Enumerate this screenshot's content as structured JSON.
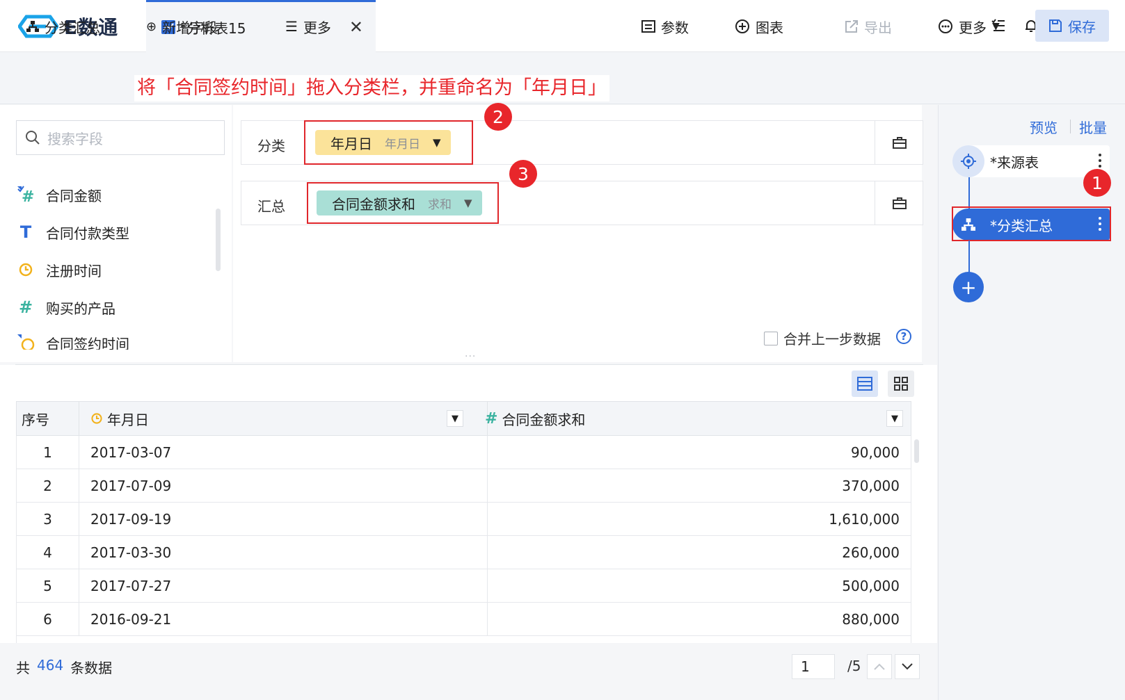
{
  "app": {
    "brand": "E数通"
  },
  "tab": {
    "title": "*分析表15",
    "close": "✕"
  },
  "toolbar": {
    "group_summary": "分类汇总",
    "new_field": "新增字段",
    "more_left": "更多",
    "params": "参数",
    "chart": "图表",
    "export": "导出",
    "more": "更多",
    "save": "保存"
  },
  "annotation": {
    "text": "将「合同签约时间」拖入分类栏，并重命名为「年月日」",
    "badge1": "1",
    "badge2": "2",
    "badge3": "3"
  },
  "search": {
    "placeholder": "搜索字段"
  },
  "fields": [
    {
      "label": "合同金额",
      "icon": "number-check-icon"
    },
    {
      "label": "合同付款类型",
      "icon": "text-icon"
    },
    {
      "label": "注册时间",
      "icon": "clock-icon"
    },
    {
      "label": "购买的产品",
      "icon": "number-icon"
    },
    {
      "label": "合同签约时间",
      "icon": "clock-check-icon"
    }
  ],
  "config": {
    "category_label": "分类",
    "category_pill": "年月日",
    "category_pill_sub": "年月日",
    "summary_label": "汇总",
    "summary_pill": "合同金额求和",
    "summary_pill_sub": "求和",
    "merge_label": "合并上一步数据",
    "help": "?"
  },
  "table": {
    "headers": [
      "序号",
      "年月日",
      "合同金额求和"
    ],
    "rows": [
      [
        "1",
        "2017-03-07",
        "90,000"
      ],
      [
        "2",
        "2017-07-09",
        "370,000"
      ],
      [
        "3",
        "2017-09-19",
        "1,610,000"
      ],
      [
        "4",
        "2017-03-30",
        "260,000"
      ],
      [
        "5",
        "2017-07-27",
        "500,000"
      ],
      [
        "6",
        "2016-09-21",
        "880,000"
      ]
    ]
  },
  "footer": {
    "prefix": "共",
    "total": "464",
    "suffix": "条数据",
    "page": "1",
    "pages": "/5"
  },
  "steps": {
    "preview": "预览",
    "batch": "批量",
    "source": "*来源表",
    "group": "*分类汇总",
    "add": "+"
  },
  "colors": {
    "accent": "#2f6bd8",
    "annotation": "#e8262b",
    "dim_pill": "#fbe39a",
    "measure_pill": "#a9dfd6"
  }
}
